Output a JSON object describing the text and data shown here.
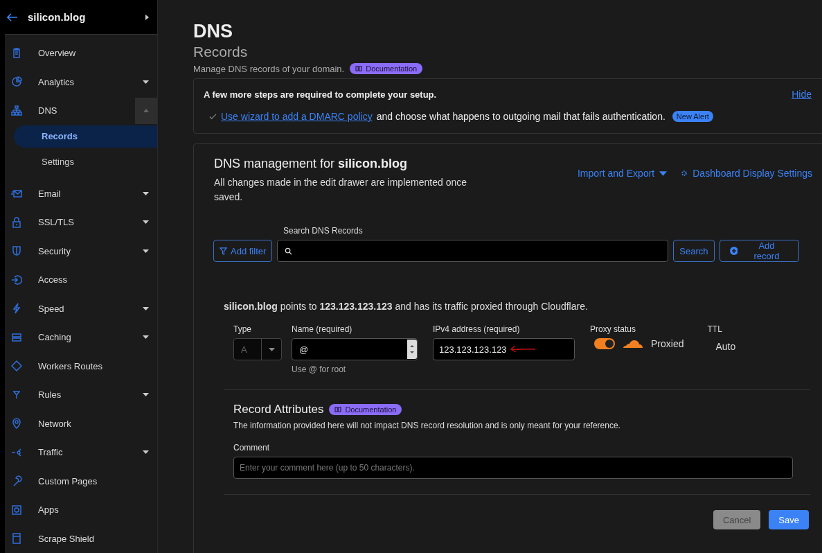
{
  "sidebar": {
    "account": "silicon.blog",
    "items": [
      {
        "label": "Overview"
      },
      {
        "label": "Analytics",
        "expanded": false
      },
      {
        "label": "DNS",
        "expanded": true,
        "children": [
          {
            "label": "Records",
            "selected": true
          },
          {
            "label": "Settings",
            "selected": false
          }
        ]
      },
      {
        "label": "Email",
        "expanded": false
      },
      {
        "label": "SSL/TLS",
        "expanded": false
      },
      {
        "label": "Security",
        "expanded": false
      },
      {
        "label": "Access"
      },
      {
        "label": "Speed",
        "expanded": false
      },
      {
        "label": "Caching",
        "expanded": false
      },
      {
        "label": "Workers Routes"
      },
      {
        "label": "Rules",
        "expanded": false
      },
      {
        "label": "Network"
      },
      {
        "label": "Traffic",
        "expanded": false
      },
      {
        "label": "Custom Pages"
      },
      {
        "label": "Apps"
      },
      {
        "label": "Scrape Shield"
      }
    ]
  },
  "header": {
    "title": "DNS",
    "subtitle": "Records",
    "description": "Manage DNS records of your domain.",
    "doc_badge": "Documentation"
  },
  "setup_alert": {
    "heading": "A few more steps are required to complete your setup.",
    "hide_link": "Hide",
    "steps": [
      {
        "done": true,
        "link": "Use wizard to add a DMARC policy",
        "text": "and choose what happens to outgoing mail that fails authentication.",
        "badge": "New Alert"
      }
    ]
  },
  "management": {
    "title": "DNS management for **silicon.blog**",
    "description": "All changes made in the edit drawer are implemented once saved.",
    "import_export": "Import and Export",
    "display_settings": "Dashboard Display Settings",
    "search_label": "Search DNS Records",
    "add_filter": "Add filter",
    "search_button": "Search",
    "add_record": "Add record"
  },
  "record": {
    "summary": "**silicon.blog** points to **123.123.123.123** and has its traffic proxied through Cloudflare.",
    "type": {
      "label": "Type",
      "value": "A",
      "disabled": true
    },
    "name": {
      "label": "Name (required)",
      "value": "@",
      "hint": "Use @ for root"
    },
    "address": {
      "label": "IPv4 address (required)",
      "value": "123.123.123.123"
    },
    "proxy": {
      "label": "Proxy status",
      "on": true,
      "text": "Proxied"
    },
    "ttl": {
      "label": "TTL",
      "value": "Auto"
    },
    "attributes_title": "Record Attributes",
    "attributes_badge": "Documentation",
    "attributes_note": "The information provided here will not impact DNS record resolution and is only meant for your reference.",
    "comment": {
      "label": "Comment",
      "placeholder": "Enter your comment here (up to 50 characters)."
    },
    "buttons": [
      {
        "label": "Cancel",
        "kind": "secondary",
        "disabled": true
      },
      {
        "label": "Save",
        "kind": "primary",
        "disabled": false
      }
    ]
  }
}
